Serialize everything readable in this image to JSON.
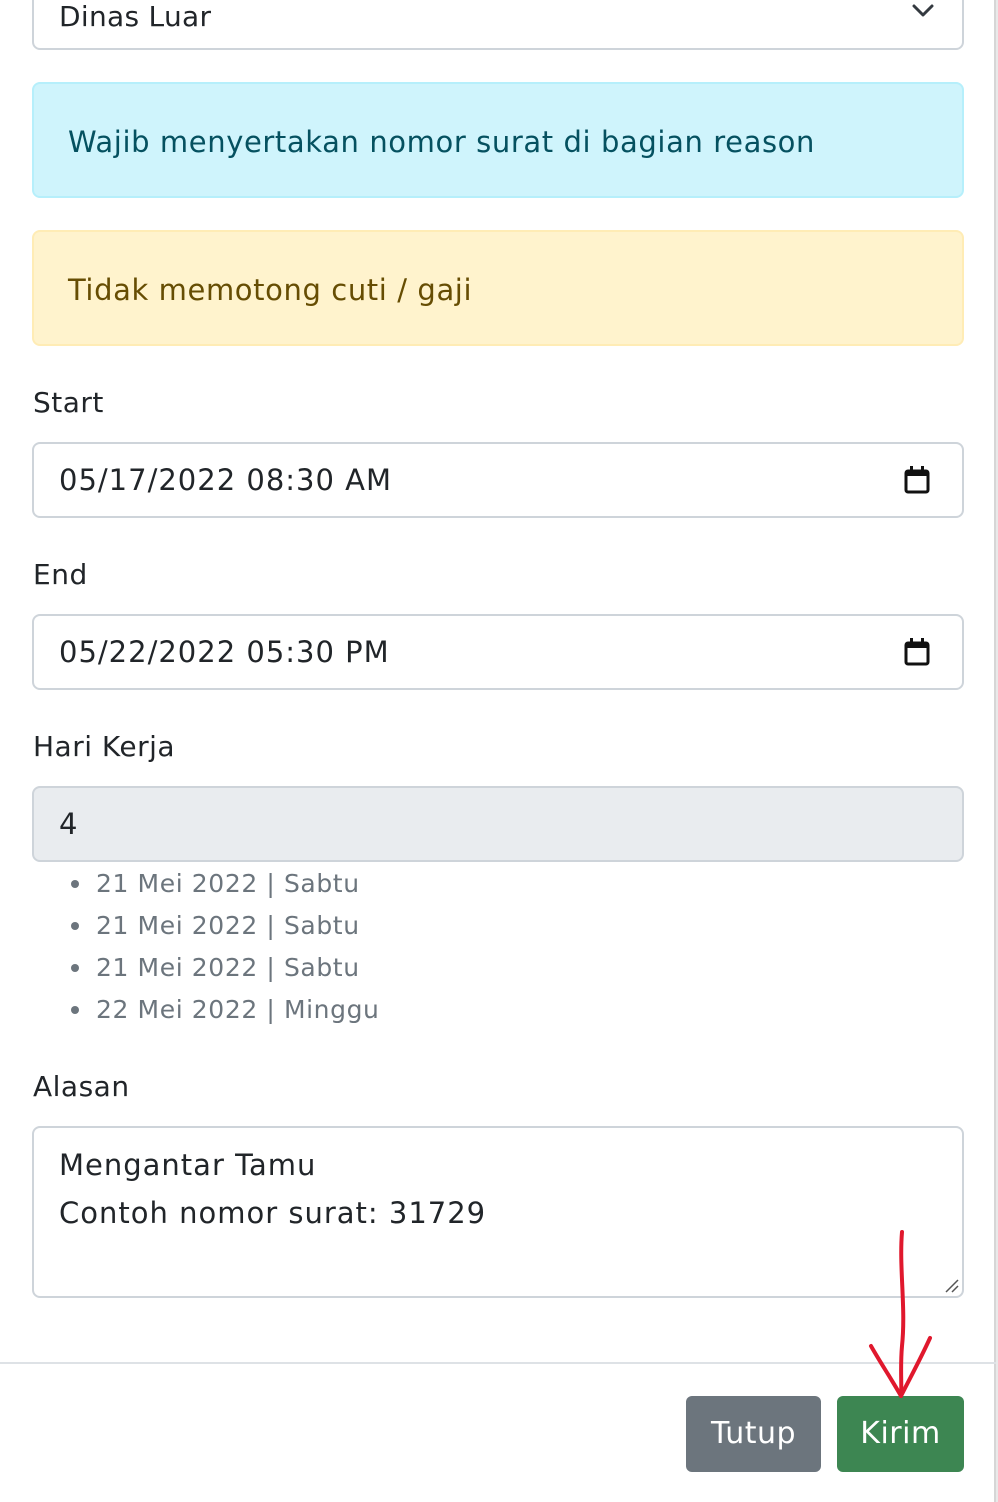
{
  "form": {
    "type_select": {
      "value": "Dinas Luar"
    },
    "alert_info": "Wajib menyertakan nomor surat di bagian reason",
    "alert_warning": "Tidak memotong cuti / gaji",
    "start": {
      "label": "Start",
      "value": "05/17/2022 08:30 AM"
    },
    "end": {
      "label": "End",
      "value": "05/22/2022 05:30 PM"
    },
    "work_days": {
      "label": "Hari Kerja",
      "value": "4",
      "dates": [
        "21 Mei 2022 | Sabtu",
        "21 Mei 2022 | Sabtu",
        "21 Mei 2022 | Sabtu",
        "22 Mei 2022 | Minggu"
      ]
    },
    "reason": {
      "label": "Alasan",
      "lines": [
        "Mengantar Tamu",
        "Contoh nomor surat: 31729"
      ]
    }
  },
  "footer": {
    "close_label": "Tutup",
    "submit_label": "Kirim"
  },
  "colors": {
    "info_bg": "#cff4fc",
    "warning_bg": "#fff3cd",
    "secondary": "#6c757d",
    "success": "#3d8652",
    "annotation_arrow": "#e0182d"
  }
}
